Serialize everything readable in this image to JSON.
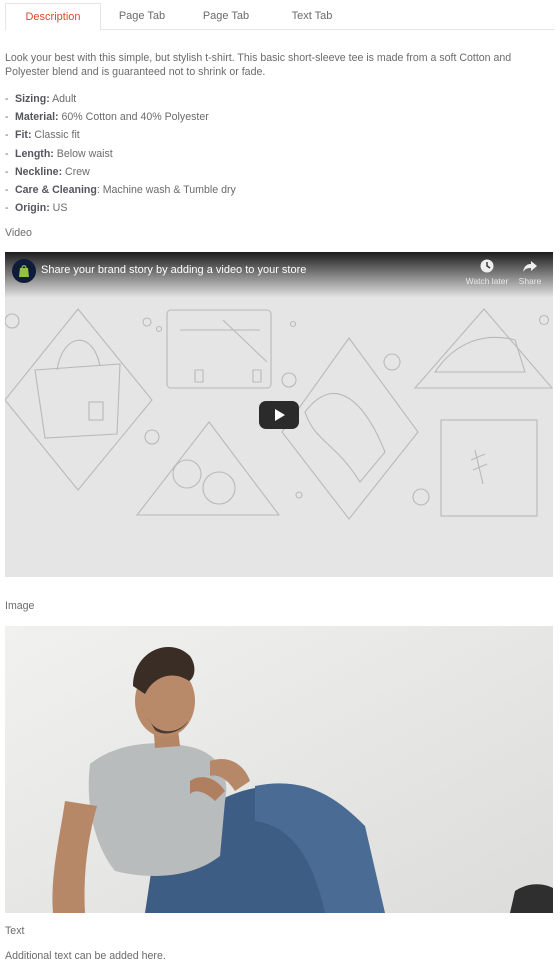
{
  "tabs": [
    {
      "label": "Description",
      "active": true
    },
    {
      "label": "Page Tab",
      "active": false
    },
    {
      "label": "Page Tab",
      "active": false
    },
    {
      "label": "Text Tab",
      "active": false
    }
  ],
  "description": {
    "intro": "Look your best with this simple, but stylish t-shirt.  This basic short-sleeve tee is made from a soft Cotton and Polyester blend and is guaranteed not to shrink or fade.",
    "specs": [
      {
        "key": "Sizing:",
        "value": " Adult"
      },
      {
        "key": "Material:",
        "value": " 60% Cotton and 40% Polyester"
      },
      {
        "key": "Fit:",
        "value": " Classic fit"
      },
      {
        "key": "Length:",
        "value": " Below waist"
      },
      {
        "key": "Neckline:",
        "value": " Crew"
      },
      {
        "key": "Care & Cleaning",
        "value": ": Machine wash & Tumble dry"
      },
      {
        "key": "Origin:",
        "value": " US"
      }
    ],
    "dash": "-"
  },
  "sections": {
    "video_label": "Video",
    "image_label": "Image",
    "text_label": "Text",
    "text_body": "Additional text can be added here."
  },
  "video": {
    "title": "Share your brand story by adding a video to your store",
    "watch_later": "Watch later",
    "share": "Share",
    "icons": [
      "shopify-bag-icon",
      "clock-icon",
      "share-arrow-icon",
      "play-icon"
    ]
  },
  "colors": {
    "active_tab": "#d94b2b",
    "text": "#6b6b6b",
    "bold_text": "#55555f",
    "video_bg": "#e5e5e5",
    "play_button": "#2b2b2b"
  }
}
